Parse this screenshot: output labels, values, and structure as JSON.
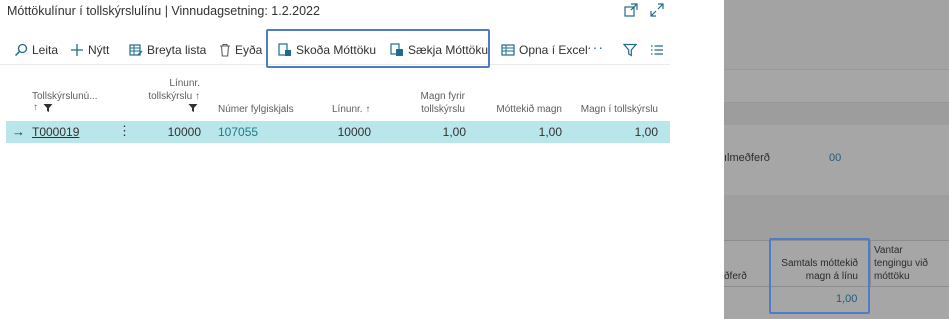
{
  "dialog": {
    "title": "Móttökulínur í tollskýrslulínu | Vinnudagsetning: 1.2.2022"
  },
  "toolbar": {
    "search_label": "Leita",
    "new_label": "Nýtt",
    "edit_list_label": "Breyta lista",
    "delete_label": "Eyða",
    "view_receipt_label": "Skoða Móttöku",
    "get_receipt_label": "Sækja Móttöku",
    "open_excel_label": "Opna í Excel",
    "more_label": "···"
  },
  "grid": {
    "headers": {
      "declaration_no": "Tollskýrslunú...",
      "line_no_line1": "Línunr.",
      "line_no_line2": "tollskýrslu",
      "waybill_no": "Númer fylgiskjals",
      "line_no2": "Línunr.",
      "qty_decl_line1": "Magn fyrir",
      "qty_decl_line2": "tollskýrslu",
      "received_qty": "Móttekið magn",
      "qty_in_decl": "Magn í tollskýrslu"
    },
    "rows": [
      {
        "declaration_no": "T000019",
        "line_no": "10000",
        "waybill_no": "107055",
        "line_no2": "10000",
        "qty_decl": "1,00",
        "received_qty": "1,00",
        "qty_in_decl": "1,00"
      }
    ]
  },
  "background": {
    "field_label": "ılmeðferð",
    "field_value": "00",
    "col_partial": "ðferð",
    "total_hdr_line1": "Samtals móttekið",
    "total_hdr_line2": "magn á línu",
    "missing_hdr_line1": "Vantar",
    "missing_hdr_line2": "tengingu við",
    "missing_hdr_line3": "móttöku",
    "total_value": "1,00"
  },
  "colors": {
    "selected_row": "#b9e6ea",
    "highlight_border": "#4f7cc4",
    "link": "#1d7a8c"
  }
}
